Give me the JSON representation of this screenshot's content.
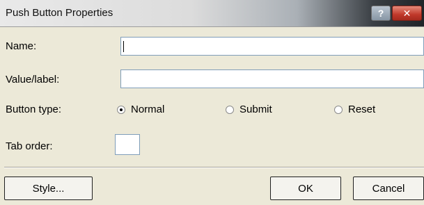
{
  "window": {
    "title": "Push Button Properties",
    "help_label": "?",
    "close_label": "✕"
  },
  "form": {
    "name_label": "Name:",
    "name_value": "",
    "value_label": "Value/label:",
    "value_value": "",
    "button_type_label": "Button type:",
    "button_types": [
      {
        "label": "Normal",
        "selected": true
      },
      {
        "label": "Submit",
        "selected": false
      },
      {
        "label": "Reset",
        "selected": false
      }
    ],
    "tab_order_label": "Tab order:",
    "tab_order_value": ""
  },
  "footer": {
    "style_label": "Style...",
    "ok_label": "OK",
    "cancel_label": "Cancel"
  }
}
